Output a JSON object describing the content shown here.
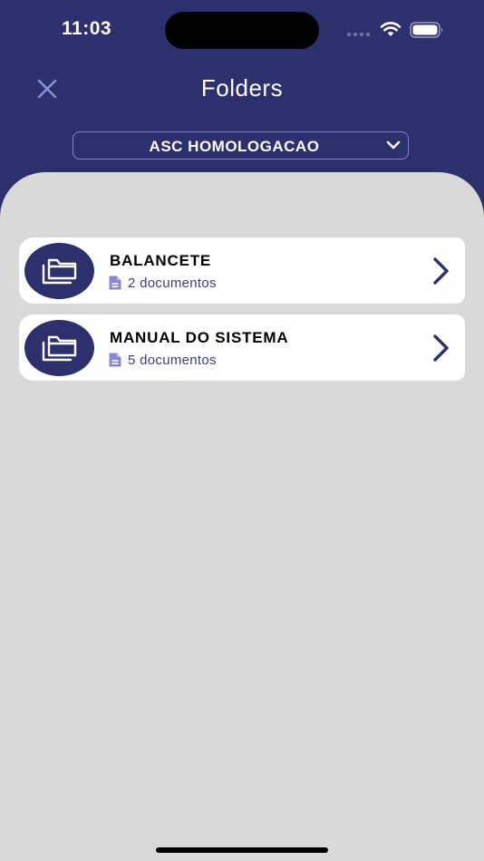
{
  "status_bar": {
    "time": "11:03"
  },
  "header": {
    "title": "Folders",
    "selector_value": "ASC HOMOLOGACAO"
  },
  "folders": [
    {
      "name": "BALANCETE",
      "count": "2 documentos"
    },
    {
      "name": "MANUAL DO SISTEMA",
      "count": "5 documentos"
    }
  ],
  "icons": {
    "close": "close-icon",
    "chevron_down": "chevron-down-icon",
    "folder": "folders-icon",
    "document": "document-icon",
    "chevron_right": "chevron-right-icon"
  },
  "colors": {
    "brand": "#2c306c",
    "content_bg": "#d9d9d9",
    "card_bg": "#ffffff",
    "doc_icon": "#8a86d0"
  }
}
